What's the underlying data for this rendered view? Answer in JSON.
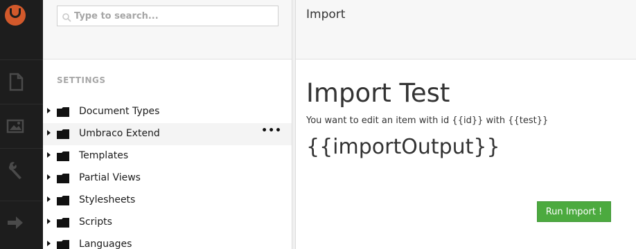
{
  "search": {
    "placeholder": "Type to search..."
  },
  "tree": {
    "section_title": "SETTINGS",
    "items": [
      {
        "label": "Document Types"
      },
      {
        "label": "Umbraco Extend",
        "more": "•••"
      },
      {
        "label": "Templates"
      },
      {
        "label": "Partial Views"
      },
      {
        "label": "Stylesheets"
      },
      {
        "label": "Scripts"
      },
      {
        "label": "Languages"
      }
    ]
  },
  "main": {
    "header_title": "Import",
    "heading": "Import Test",
    "subtext": "You want to edit an item with id {{id}} with {{test}}",
    "output": "{{importOutput}}",
    "run_button": "Run Import !"
  },
  "colors": {
    "rail_bg": "#1d1d1d",
    "logo": "#d2592b",
    "button_bg": "#4caa3f"
  },
  "icons": [
    "umbraco-logo-icon",
    "document-icon",
    "media-icon",
    "wrench-icon",
    "arrow-right-icon",
    "search-icon",
    "folder-icon",
    "caret-right-icon",
    "more-icon"
  ]
}
